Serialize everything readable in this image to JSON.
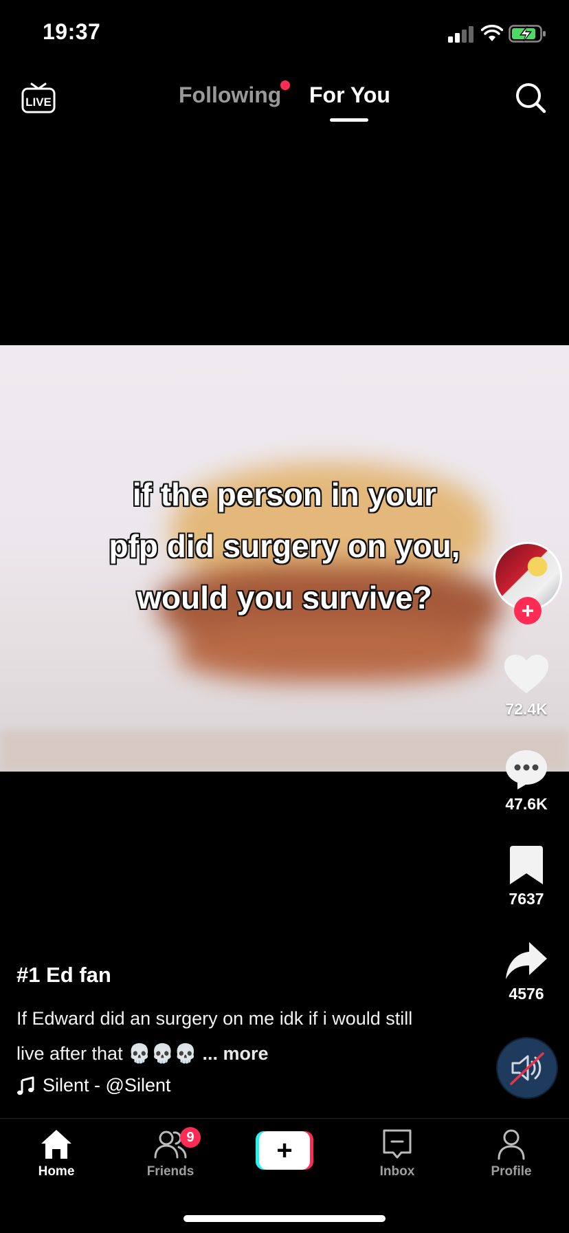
{
  "status_bar": {
    "time": "19:37"
  },
  "top_nav": {
    "live_label": "LIVE",
    "tabs": [
      {
        "label": "Following",
        "has_dot": true,
        "active": false
      },
      {
        "label": "For You",
        "active": true
      }
    ]
  },
  "video": {
    "overlay_text_lines": [
      "if the person in your",
      "pfp did surgery on you,",
      "would you survive?"
    ]
  },
  "actions": {
    "like_count": "72.4K",
    "comment_count": "47.6K",
    "save_count": "7637",
    "share_count": "4576",
    "follow_label": "+"
  },
  "caption": {
    "author": "#1 Ed fan",
    "text": "If Edward did an surgery on me idk if i would still live after that 💀💀💀",
    "more": "... more",
    "sound": "Silent - @Silent"
  },
  "bottom_nav": {
    "items": [
      {
        "label": "Home"
      },
      {
        "label": "Friends",
        "badge": "9"
      },
      {
        "label": "+"
      },
      {
        "label": "Inbox"
      },
      {
        "label": "Profile"
      }
    ]
  },
  "colors": {
    "accent": "#fe2c55",
    "create_cyan": "#25f4ee",
    "sound_button": "#1e3a5c"
  }
}
